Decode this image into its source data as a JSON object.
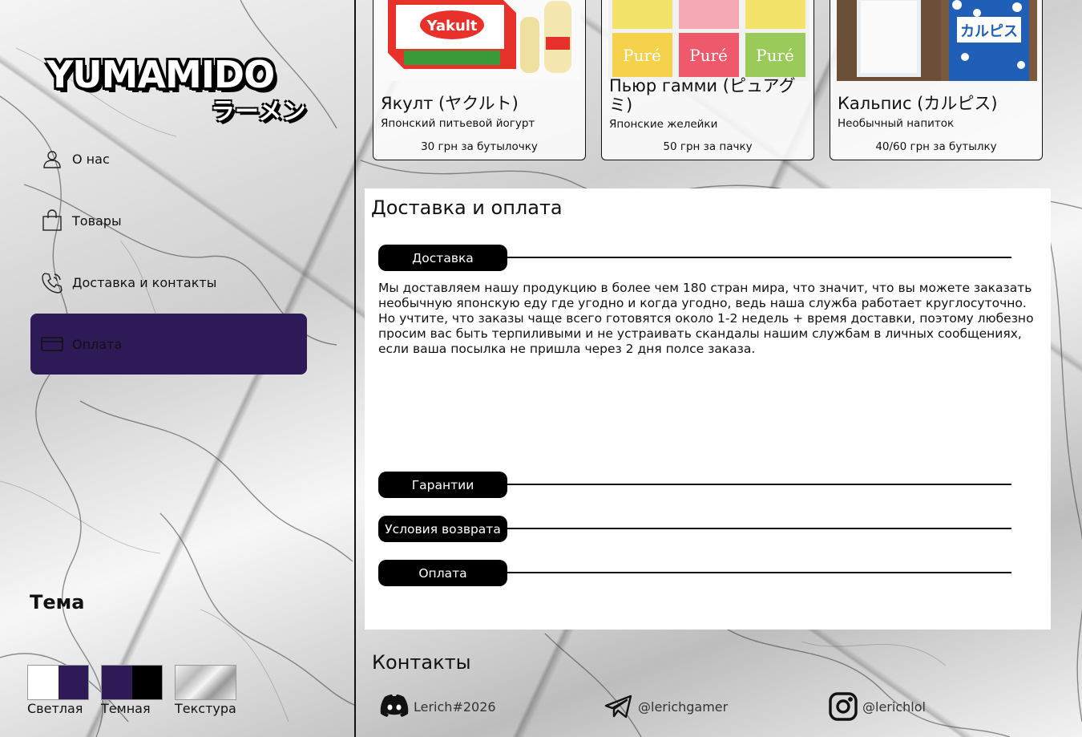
{
  "brand": {
    "logo_text": "YUMAMIDO",
    "logo_kana": "ラーメン"
  },
  "nav": {
    "items": [
      {
        "label": "О нас",
        "icon": "user-icon",
        "active": false
      },
      {
        "label": "Товары",
        "icon": "shopping-bag-icon",
        "active": false
      },
      {
        "label": "Доставка и контакты",
        "icon": "phone-icon",
        "active": false
      },
      {
        "label": "Оплата",
        "icon": "credit-card-icon",
        "active": true
      }
    ]
  },
  "theme": {
    "title": "Тема",
    "options": [
      {
        "label": "Светлая",
        "colors": [
          "#ffffff",
          "#2e1a57"
        ]
      },
      {
        "label": "Темная",
        "colors": [
          "#2e1a57",
          "#000000"
        ]
      },
      {
        "label": "Текстура",
        "colors": [
          "#d8d8d8",
          "#f0f0f0"
        ]
      }
    ]
  },
  "products": [
    {
      "name": "Якулт (ヤクルト)",
      "description": "Японский питьевой йогурт",
      "price": "30 грн за бутылочку",
      "image": "yakult-image"
    },
    {
      "name": "Пьюр гамми (ピュアグミ)",
      "description": "Японские желейки",
      "price": "50 грн за пачку",
      "image": "pure-gummy-image"
    },
    {
      "name": "Кальпис (カルピス)",
      "description": "Необычный напиток",
      "price": "40/60 грн за бутылку",
      "image": "calpis-image"
    }
  ],
  "delivery": {
    "title": "Доставка и оплата",
    "sections": [
      {
        "label": "Доставка",
        "expanded": true,
        "text": "Мы доставляем нашу продукцию в более чем 180 стран мира, что значит, что вы можете заказать необычную японскую еду где угодно и когда угодно, ведь наша служба работает круглосуточно. Но учтите, что заказы чаще всего готовятся около 1-2 недель + время доставки, поэтому любезно просим вас быть терпиливыми и не устраивать скандалы нашим службам в личных сообщениях, если ваша посылка не пришла через 2 дня полсе заказа."
      },
      {
        "label": "Гарантии",
        "expanded": false
      },
      {
        "label": "Условия возврата",
        "expanded": false
      },
      {
        "label": "Оплата",
        "expanded": false
      }
    ]
  },
  "contacts": {
    "title": "Контакты",
    "items": [
      {
        "icon": "discord-icon",
        "handle": "Lerich#2026"
      },
      {
        "icon": "telegram-icon",
        "handle": "@lerichgamer"
      },
      {
        "icon": "instagram-icon",
        "handle": "@lerichlol"
      }
    ]
  },
  "colors": {
    "accent": "#2e1a57",
    "pill": "#000000",
    "panel": "#ffffff"
  }
}
